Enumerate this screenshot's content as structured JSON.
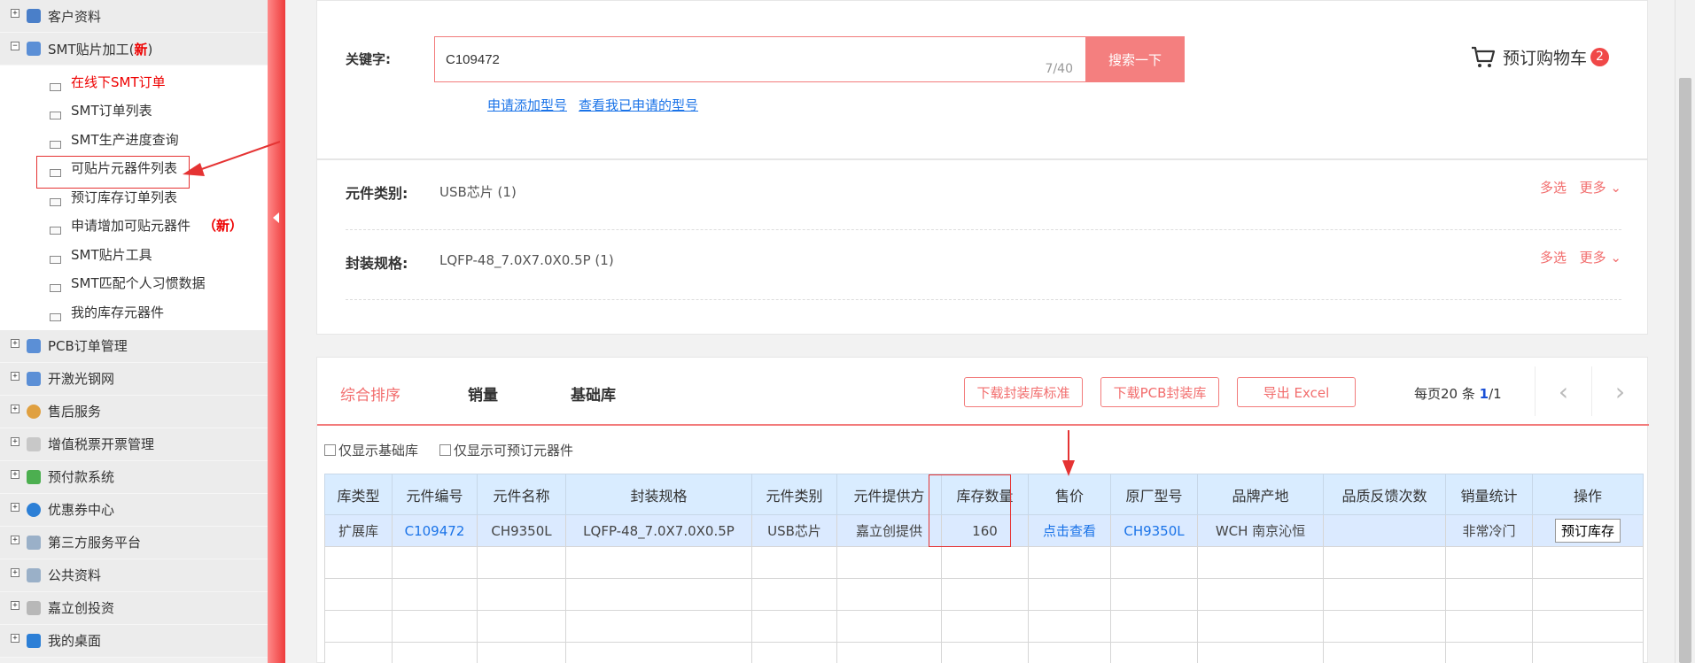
{
  "sidebar": {
    "menus_top": [
      {
        "label": "客户资料",
        "toggle": "+"
      },
      {
        "label": "SMT贴片加工(",
        "new": "新",
        "suffix": ")",
        "toggle": "−"
      }
    ],
    "submenu": [
      {
        "label": "在线下SMT订单"
      },
      {
        "label": "SMT订单列表"
      },
      {
        "label": "SMT生产进度查询"
      },
      {
        "label": "可贴片元器件列表"
      },
      {
        "label": "预订库存订单列表"
      },
      {
        "label": "申请增加可贴元器件",
        "new": "（新）"
      },
      {
        "label": "SMT贴片工具"
      },
      {
        "label": "SMT匹配个人习惯数据"
      },
      {
        "label": "我的库存元器件"
      }
    ],
    "menus_bottom": [
      {
        "label": "PCB订单管理"
      },
      {
        "label": "开激光钢网"
      },
      {
        "label": "售后服务"
      },
      {
        "label": "增值税票开票管理"
      },
      {
        "label": "预付款系统"
      },
      {
        "label": "优惠券中心"
      },
      {
        "label": "第三方服务平台"
      },
      {
        "label": "公共资料"
      },
      {
        "label": "嘉立创投资"
      },
      {
        "label": "我的桌面"
      }
    ]
  },
  "search": {
    "label": "关键字:",
    "value": "C109472",
    "count": "7/40",
    "button": "搜索一下",
    "link_apply": "申请添加型号",
    "link_view": "查看我已申请的型号"
  },
  "cart": {
    "label": "预订购物车",
    "count": "2"
  },
  "filters": [
    {
      "label": "元件类别:",
      "value": "USB芯片  (1)",
      "multi": "多选",
      "more": "更多"
    },
    {
      "label": "封装规格:",
      "value": "LQFP-48_7.0X7.0X0.5P  (1)",
      "multi": "多选",
      "more": "更多"
    }
  ],
  "sort": {
    "tabs": [
      "综合排序",
      "销量",
      "基础库"
    ],
    "buttons": [
      "下载封装库标准",
      "下载PCB封装库",
      "导出 Excel"
    ],
    "per_page_prefix": "每页20  条 ",
    "page_current": "1",
    "page_total": "/1"
  },
  "checkboxes": [
    "仅显示基础库",
    "仅显示可预订元器件"
  ],
  "table": {
    "headers": [
      "库类型",
      "元件编号",
      "元件名称",
      "封装规格",
      "元件类别",
      "元件提供方",
      "库存数量",
      "售价",
      "原厂型号",
      "品牌产地",
      "品质反馈次数",
      "销量统计",
      "操作"
    ],
    "row": {
      "lib_type": "扩展库",
      "part_no": "C109472",
      "name": "CH9350L",
      "package": "LQFP-48_7.0X7.0X0.5P",
      "category": "USB芯片",
      "provider": "嘉立创提供",
      "stock": "160",
      "price": "点击查看",
      "mfr_part": "CH9350L",
      "brand": "WCH 南京沁恒",
      "feedback": "",
      "sales": "非常冷门",
      "action": "预订库存"
    }
  },
  "colors": {
    "accent": "#f27b7b",
    "link": "#1a73e8",
    "annotation": "#e53333"
  }
}
